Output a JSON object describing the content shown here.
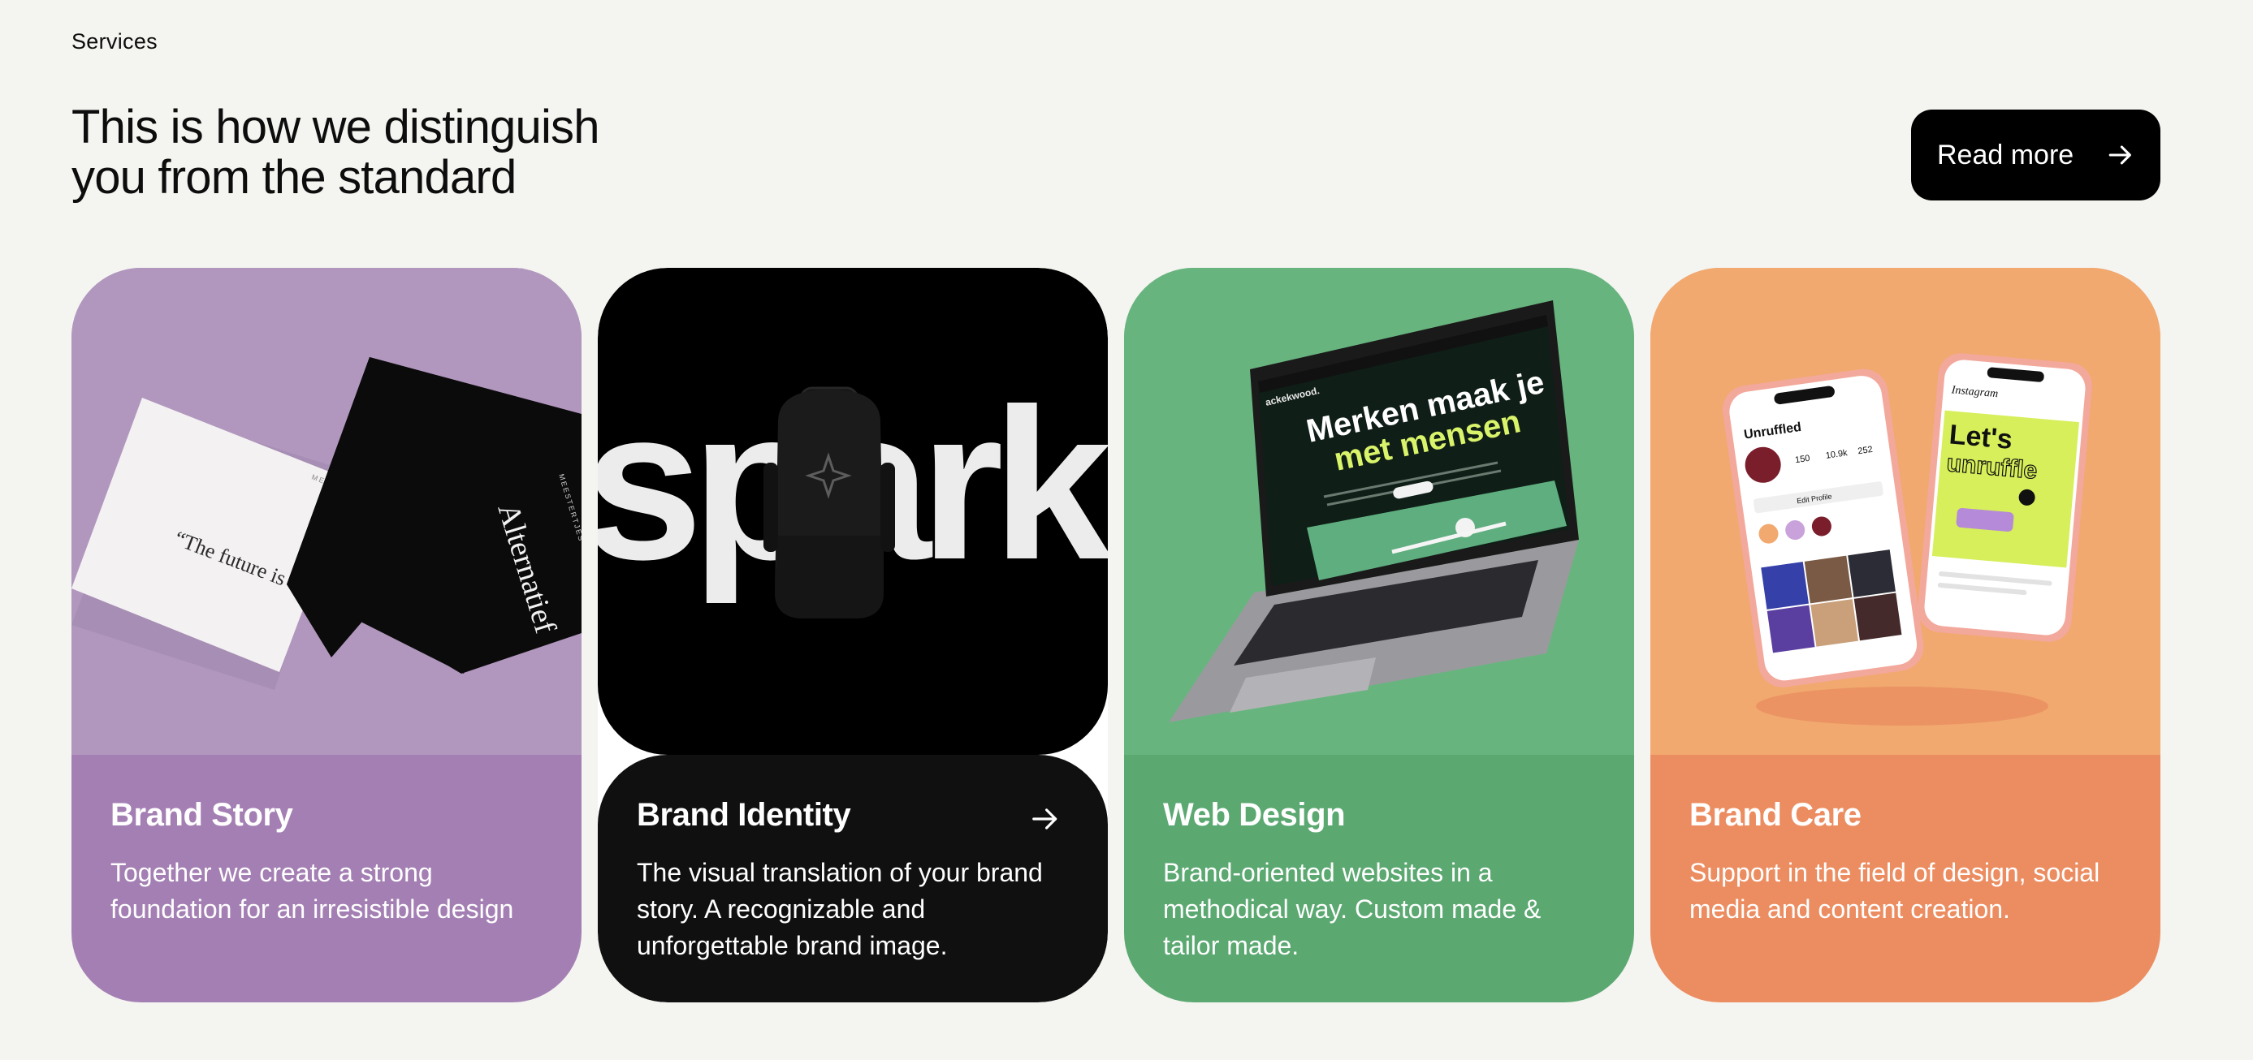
{
  "section": {
    "eyebrow": "Services",
    "heading_line1": "This is how we distinguish",
    "heading_line2": "you from the standard",
    "read_more_label": "Read more"
  },
  "cards": [
    {
      "title": "Brand Story",
      "description": "Together we create a strong foundation for an irresistible design",
      "image_text": {
        "quote": "“The future is what we make it.”",
        "brand": "Alternatief"
      },
      "background": "#a47fb3"
    },
    {
      "title": "Brand Identity",
      "description": "The visual translation of your brand story. A recognizable and unforgettable brand image.",
      "image_text": {
        "word": "spark"
      },
      "background": "#101010"
    },
    {
      "title": "Web Design",
      "description": "Brand-oriented websites in a methodical way. Custom made & tailor made.",
      "image_text": {
        "headline_line1": "Merken maak je",
        "headline_line2": "met mensen",
        "logo": "ackekwood."
      },
      "background": "#5ba871"
    },
    {
      "title": "Brand Care",
      "description": "Support in the field of design, social media and content creation.",
      "image_text": {
        "profile_name": "Unruffled",
        "app_name": "Instagram",
        "post_line1": "Let's",
        "post_line2": "unruffle",
        "edit_profile": "Edit Profile",
        "stats": [
          "150",
          "10.9k",
          "252"
        ]
      },
      "background": "#ec8d61"
    }
  ],
  "icons": {
    "read_more": "arrow-right-icon",
    "identity_card": "arrow-right-icon"
  },
  "colors": {
    "page_bg": "#f4f4f0",
    "button_bg": "#000000",
    "story": "#a47fb3",
    "identity": "#101010",
    "web": "#5ba871",
    "care": "#ec8d61"
  }
}
